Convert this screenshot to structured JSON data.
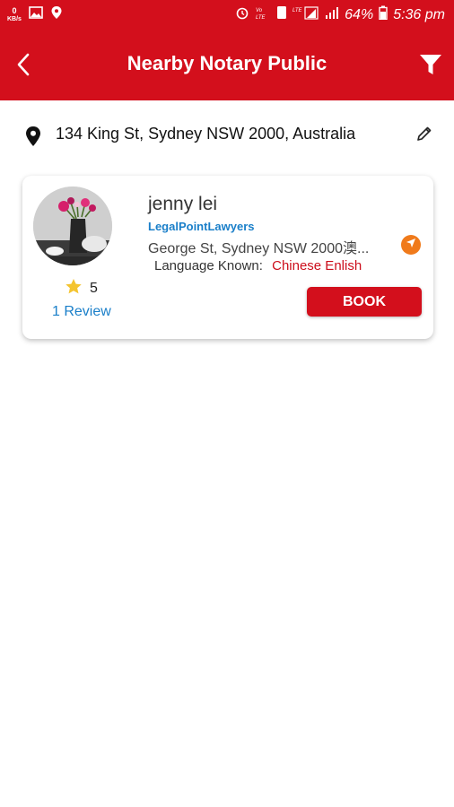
{
  "status_bar": {
    "net_speed_value": "0",
    "net_speed_unit": "KB/s",
    "battery_percent": "64%",
    "time": "5:36 pm"
  },
  "app_bar": {
    "title": "Nearby Notary Public"
  },
  "location": {
    "address": "134 King St, Sydney NSW 2000, Australia"
  },
  "results": [
    {
      "name": "jenny lei",
      "company": "LegalPointLawyers",
      "address": "George St, Sydney NSW 2000澳...",
      "language_label": "Language Known:",
      "languages": "Chinese Enlish",
      "rating": "5",
      "reviews": "1 Review",
      "book_label": "BOOK"
    }
  ],
  "colors": {
    "primary": "#d30f1c",
    "link": "#1a7fc9",
    "navigate": "#f07a1b",
    "star": "#f4c430"
  }
}
